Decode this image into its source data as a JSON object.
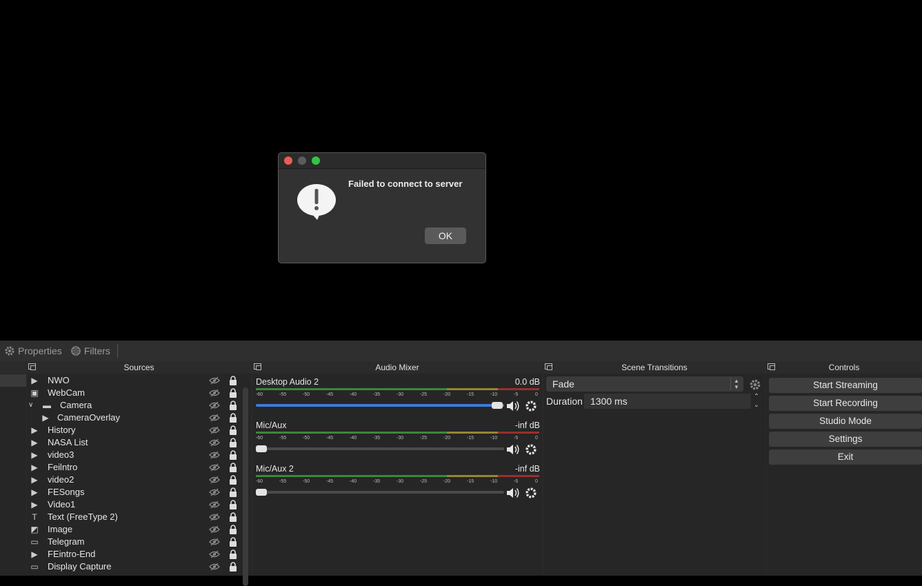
{
  "toolbar": {
    "properties_label": "Properties",
    "filters_label": "Filters"
  },
  "docks": {
    "sources_title": "Sources",
    "mixer_title": "Audio Mixer",
    "transitions_title": "Scene Transitions",
    "controls_title": "Controls"
  },
  "sources": [
    {
      "name": "NWO",
      "icon": "play-icon"
    },
    {
      "name": "WebCam",
      "icon": "camera-icon"
    },
    {
      "name": "Camera",
      "icon": "folder-icon"
    },
    {
      "name": "CameraOverlay",
      "icon": "play-icon"
    },
    {
      "name": "History",
      "icon": "play-icon"
    },
    {
      "name": "NASA List",
      "icon": "play-icon"
    },
    {
      "name": "video3",
      "icon": "play-icon"
    },
    {
      "name": "Feilntro",
      "icon": "play-icon"
    },
    {
      "name": "video2",
      "icon": "play-icon"
    },
    {
      "name": "FESongs",
      "icon": "play-icon"
    },
    {
      "name": "Video1",
      "icon": "play-icon"
    },
    {
      "name": "Text (FreeType 2)",
      "icon": "text-icon"
    },
    {
      "name": "Image",
      "icon": "image-icon"
    },
    {
      "name": "Telegram",
      "icon": "window-icon"
    },
    {
      "name": "FEintro-End",
      "icon": "play-icon"
    },
    {
      "name": "Display Capture",
      "icon": "monitor-icon"
    }
  ],
  "mixer": {
    "ticks": [
      "-60",
      "-55",
      "-50",
      "-45",
      "-40",
      "-35",
      "-30",
      "-25",
      "-20",
      "-15",
      "-10",
      "-5",
      "0"
    ],
    "channels": [
      {
        "name": "Desktop Audio 2",
        "db": "0.0 dB",
        "volume": 1.0
      },
      {
        "name": "Mic/Aux",
        "db": "-inf dB",
        "volume": 0.0
      },
      {
        "name": "Mic/Aux 2",
        "db": "-inf dB",
        "volume": 0.0
      }
    ]
  },
  "transitions": {
    "selected": "Fade",
    "duration_label": "Duration",
    "duration_value": "1300 ms"
  },
  "controls": {
    "start_streaming": "Start Streaming",
    "start_recording": "Start Recording",
    "studio_mode": "Studio Mode",
    "settings": "Settings",
    "exit": "Exit"
  },
  "dialog": {
    "message": "Failed to connect to server",
    "ok_label": "OK"
  },
  "colors": {
    "accent": "#3c7bd8",
    "meter_green": "#3f9a3f",
    "meter_yellow": "#a89a30",
    "meter_red": "#b03030"
  }
}
